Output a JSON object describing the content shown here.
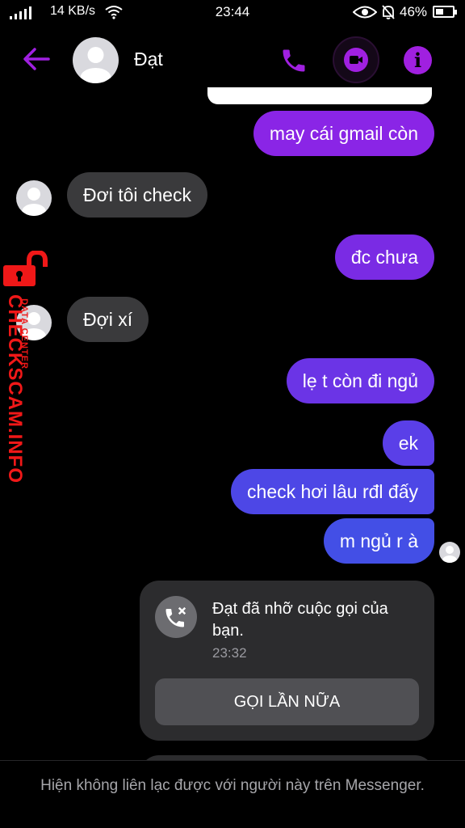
{
  "status_bar": {
    "net_speed": "14 KB/s",
    "time": "23:44",
    "battery": "46%",
    "battery_level": 0.46
  },
  "header": {
    "contact_name": "Đạt",
    "accent_color": "#a020e0"
  },
  "messages": [
    {
      "direction": "out",
      "text": "may cái gmail còn",
      "color": "#8a25e6"
    },
    {
      "direction": "in",
      "text": "Đơi  tôi check"
    },
    {
      "direction": "out",
      "text": "đc chưa",
      "color": "#7a2be4"
    },
    {
      "direction": "in",
      "text": "Đợi xí"
    },
    {
      "direction": "out",
      "text": "lẹ t còn đi ngủ",
      "color": "#6b34e6"
    },
    {
      "direction": "out",
      "text": "ek",
      "color": "#5a3fe8"
    },
    {
      "direction": "out",
      "text": "check hơi lâu rđl đấy",
      "color": "#4d47e6"
    },
    {
      "direction": "out",
      "text": "m ngủ r à",
      "color": "#434fe6"
    }
  ],
  "missed_call": {
    "text": "Đạt đã nhỡ cuộc gọi của bạn.",
    "time": "23:32",
    "button_label": "GỌI LẦN NỮA"
  },
  "watermark": {
    "main": "CHECKSCAM.INFO",
    "sub": "DATA CENTER"
  },
  "footer": {
    "text": "Hiện không liên lạc được với người này trên Messenger."
  },
  "icons": [
    "signal-icon",
    "wifi-icon",
    "eye-icon",
    "bell-off-icon",
    "battery-icon",
    "back-arrow-icon",
    "phone-icon",
    "video-icon",
    "info-icon",
    "missed-call-icon",
    "lock-icon"
  ]
}
